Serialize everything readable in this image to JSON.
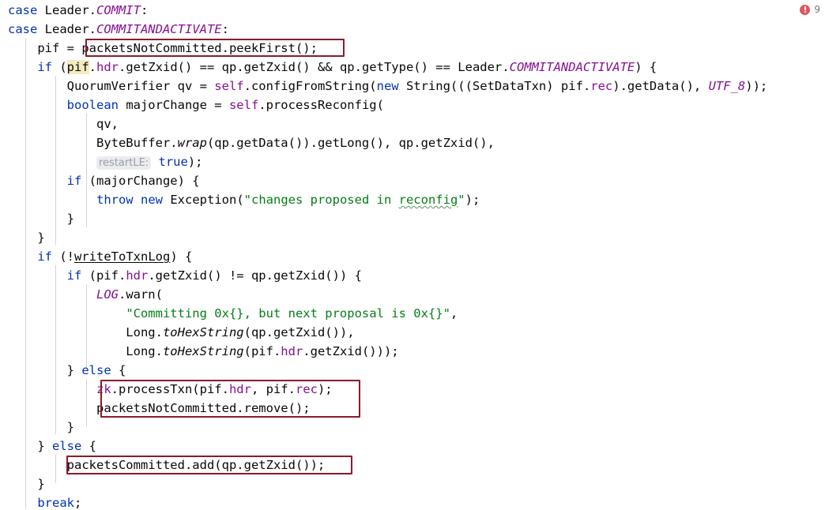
{
  "editor": {
    "language": "java",
    "background_color": "#ffffff",
    "font_size_px": 15.5,
    "line_height_px": 24,
    "colors": {
      "keyword": "#0033b3",
      "string": "#067d17",
      "static_field": "#871094",
      "instance_field": "#871094",
      "plain_text": "#080808",
      "number": "#1750eb",
      "highlight_box_border": "#8b1a2b",
      "identifier_highlight_bg": "#f6ebbe",
      "inlay_hint_bg": "#ebecf0",
      "inlay_hint_fg": "#999da5",
      "indent_guide": "#d3d3d3",
      "error_badge": "#db5860",
      "error_count_text": "#6e7a8c",
      "spellcheck_wave": "#4e9a57"
    }
  },
  "inspection_widget": {
    "icon": "error-circle-icon",
    "error_count": "9"
  },
  "code": {
    "lines": [
      {
        "n": 1,
        "text": "case Leader.COMMIT:"
      },
      {
        "n": 2,
        "text": "case Leader.COMMITANDACTIVATE:"
      },
      {
        "n": 3,
        "text": "    pif = packetsNotCommitted.peekFirst();"
      },
      {
        "n": 4,
        "text": "    if (pif.hdr.getZxid() == qp.getZxid() && qp.getType() == Leader.COMMITANDACTIVATE) {"
      },
      {
        "n": 5,
        "text": "        QuorumVerifier qv = self.configFromString(new String(((SetDataTxn) pif.rec).getData(), UTF_8));"
      },
      {
        "n": 6,
        "text": "        boolean majorChange = self.processReconfig("
      },
      {
        "n": 7,
        "text": "            qv,"
      },
      {
        "n": 8,
        "text": "            ByteBuffer.wrap(qp.getData()).getLong(), qp.getZxid(),"
      },
      {
        "n": 9,
        "text": "            restartLE: true);"
      },
      {
        "n": 10,
        "text": "        if (majorChange) {"
      },
      {
        "n": 11,
        "text": "            throw new Exception(\"changes proposed in reconfig\");"
      },
      {
        "n": 12,
        "text": "        }"
      },
      {
        "n": 13,
        "text": "    }"
      },
      {
        "n": 14,
        "text": "    if (!writeToTxnLog) {"
      },
      {
        "n": 15,
        "text": "        if (pif.hdr.getZxid() != qp.getZxid()) {"
      },
      {
        "n": 16,
        "text": "            LOG.warn("
      },
      {
        "n": 17,
        "text": "                \"Committing 0x{}, but next proposal is 0x{}\","
      },
      {
        "n": 18,
        "text": "                Long.toHexString(qp.getZxid()),"
      },
      {
        "n": 19,
        "text": "                Long.toHexString(pif.hdr.getZxid()));"
      },
      {
        "n": 20,
        "text": "        } else {"
      },
      {
        "n": 21,
        "text": "            zk.processTxn(pif.hdr, pif.rec);"
      },
      {
        "n": 22,
        "text": "            packetsNotCommitted.remove();"
      },
      {
        "n": 23,
        "text": "        }"
      },
      {
        "n": 24,
        "text": "    } else {"
      },
      {
        "n": 25,
        "text": "        packetsCommitted.add(qp.getZxid());"
      },
      {
        "n": 26,
        "text": "    }"
      },
      {
        "n": 27,
        "text": "    break;"
      }
    ],
    "tokens": {
      "kw_case": "case",
      "kw_if": "if",
      "kw_else": "else",
      "kw_new": "new",
      "kw_throw": "throw",
      "kw_boolean": "boolean",
      "kw_break": "break",
      "kw_true": "true",
      "const_commit": "COMMIT",
      "const_commitandactivate": "COMMITANDACTIVATE",
      "const_utf8": "UTF_8",
      "const_log": "LOG",
      "field_self": "self",
      "field_zk": "zk",
      "field_hdr": "hdr",
      "field_rec": "rec",
      "method_wrap": "wrap",
      "method_tohexstring": "toHexString",
      "string_reconfig_msg": "\"changes proposed in reconfig\"",
      "string_committing_msg": "\"Committing 0x{}, but next proposal is 0x{}\"",
      "inlay_restartle": "restartLE:"
    }
  },
  "highlight_boxes": [
    {
      "id": 1,
      "label": "packetsNotCommitted.peekFirst();",
      "line": 3
    },
    {
      "id": 2,
      "label": "zk.processTxn(pif.hdr, pif.rec);",
      "line": 21
    },
    {
      "id": 3,
      "label": "packetsNotCommitted.remove();",
      "line": 22
    },
    {
      "id": 4,
      "label": "packetsCommitted.add(qp.getZxid());",
      "line": 25
    }
  ]
}
